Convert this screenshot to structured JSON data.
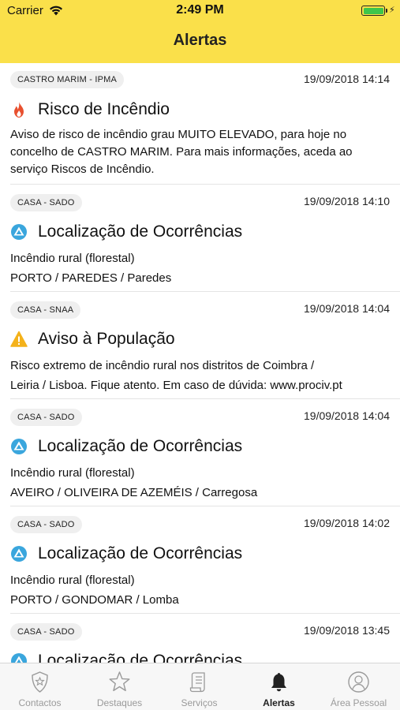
{
  "status_bar": {
    "carrier": "Carrier",
    "time": "2:49 PM",
    "battery_color": "#3ec64b"
  },
  "nav": {
    "title": "Alertas",
    "bar_color": "#fae04a"
  },
  "alerts": [
    {
      "source": "CASTRO MARIM - IPMA",
      "datetime": "19/09/2018 14:14",
      "icon": "fire-icon",
      "title": "Risco de Incêndio",
      "line1": "Aviso de risco de incêndio grau MUITO ELEVADO, para hoje no",
      "line2": "concelho de CASTRO MARIM. Para mais informações, aceda ao",
      "line3": "serviço Riscos de Incêndio."
    },
    {
      "source": "CASA - SADO",
      "datetime": "19/09/2018 14:10",
      "icon": "occurrence-location-icon",
      "title": "Localização de Ocorrências",
      "line1": "Incêndio rural (florestal)",
      "line2": "PORTO / PAREDES / Paredes"
    },
    {
      "source": "CASA - SNAA",
      "datetime": "19/09/2018 14:04",
      "icon": "warning-icon",
      "title": "Aviso à População",
      "line1": "Risco extremo de incêndio rural nos distritos de Coimbra /",
      "line2": "Leiria / Lisboa. Fique atento. Em caso de dúvida: www.prociv.pt"
    },
    {
      "source": "CASA - SADO",
      "datetime": "19/09/2018 14:04",
      "icon": "occurrence-location-icon",
      "title": "Localização de Ocorrências",
      "line1": "Incêndio rural (florestal)",
      "line2": "AVEIRO / OLIVEIRA DE AZEMÉIS / Carregosa"
    },
    {
      "source": "CASA - SADO",
      "datetime": "19/09/2018 14:02",
      "icon": "occurrence-location-icon",
      "title": "Localização de Ocorrências",
      "line1": "Incêndio rural (florestal)",
      "line2": "PORTO / GONDOMAR / Lomba"
    },
    {
      "source": "CASA - SADO",
      "datetime": "19/09/2018 13:45",
      "icon": "occurrence-location-icon",
      "title": "Localização de Ocorrências"
    }
  ],
  "tabs": [
    {
      "label": "Contactos",
      "icon": "badge-icon",
      "active": false
    },
    {
      "label": "Destaques",
      "icon": "star-icon",
      "active": false
    },
    {
      "label": "Serviços",
      "icon": "scroll-icon",
      "active": false
    },
    {
      "label": "Alertas",
      "icon": "bell-icon",
      "active": true
    },
    {
      "label": "Área Pessoal",
      "icon": "user-icon",
      "active": false
    }
  ]
}
